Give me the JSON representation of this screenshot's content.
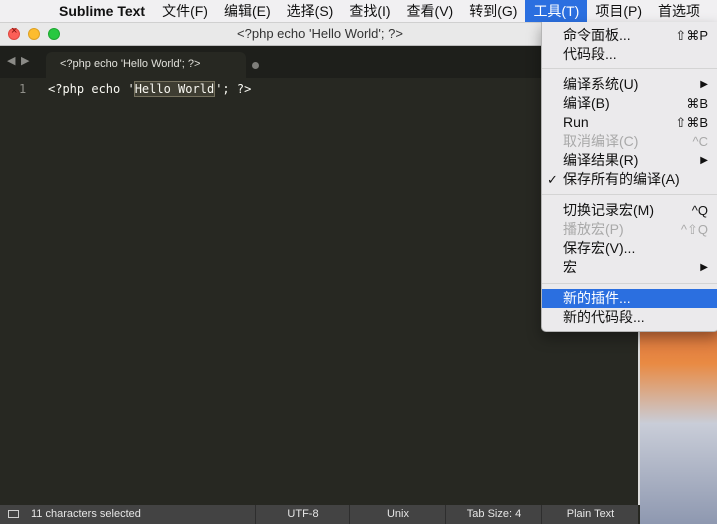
{
  "menubar": {
    "app_name": "Sublime Text",
    "items": [
      "文件(F)",
      "编辑(E)",
      "选择(S)",
      "查找(I)",
      "查看(V)",
      "转到(G)",
      "工具(T)",
      "项目(P)",
      "首选项"
    ],
    "active_index": 6
  },
  "window": {
    "title": "<?php echo 'Hello World'; ?>"
  },
  "tab": {
    "label": "<?php echo 'Hello World'; ?>"
  },
  "editor": {
    "line_number": "1",
    "code_before": "<?php echo '",
    "code_selected": "Hello World",
    "code_after": "'; ?>"
  },
  "statusbar": {
    "selection": "11 characters selected",
    "encoding": "UTF-8",
    "line_endings": "Unix",
    "tab_size": "Tab Size: 4",
    "syntax": "Plain Text"
  },
  "tools_menu": {
    "command_palette": {
      "label": "命令面板...",
      "shortcut": "⇧⌘P"
    },
    "snippets": {
      "label": "代码段..."
    },
    "build_system": {
      "label": "编译系统(U)"
    },
    "build": {
      "label": "编译(B)",
      "shortcut": "⌘B"
    },
    "run": {
      "label": "Run",
      "shortcut": "⇧⌘B"
    },
    "cancel_build": {
      "label": "取消编译(C)",
      "shortcut": "^C"
    },
    "build_results": {
      "label": "编译结果(R)"
    },
    "save_all_on_build": {
      "label": "保存所有的编译(A)",
      "check": "✓"
    },
    "record_macro": {
      "label": "切换记录宏(M)",
      "shortcut": "^Q"
    },
    "playback_macro": {
      "label": "播放宏(P)",
      "shortcut": "^⇧Q"
    },
    "save_macro": {
      "label": "保存宏(V)..."
    },
    "macros": {
      "label": "宏"
    },
    "new_plugin": {
      "label": "新的插件..."
    },
    "new_snippet": {
      "label": "新的代码段..."
    }
  },
  "colors": {
    "editor_bg": "#272822",
    "menu_highlight": "#2b6fe0",
    "status_bg": "#434343"
  }
}
